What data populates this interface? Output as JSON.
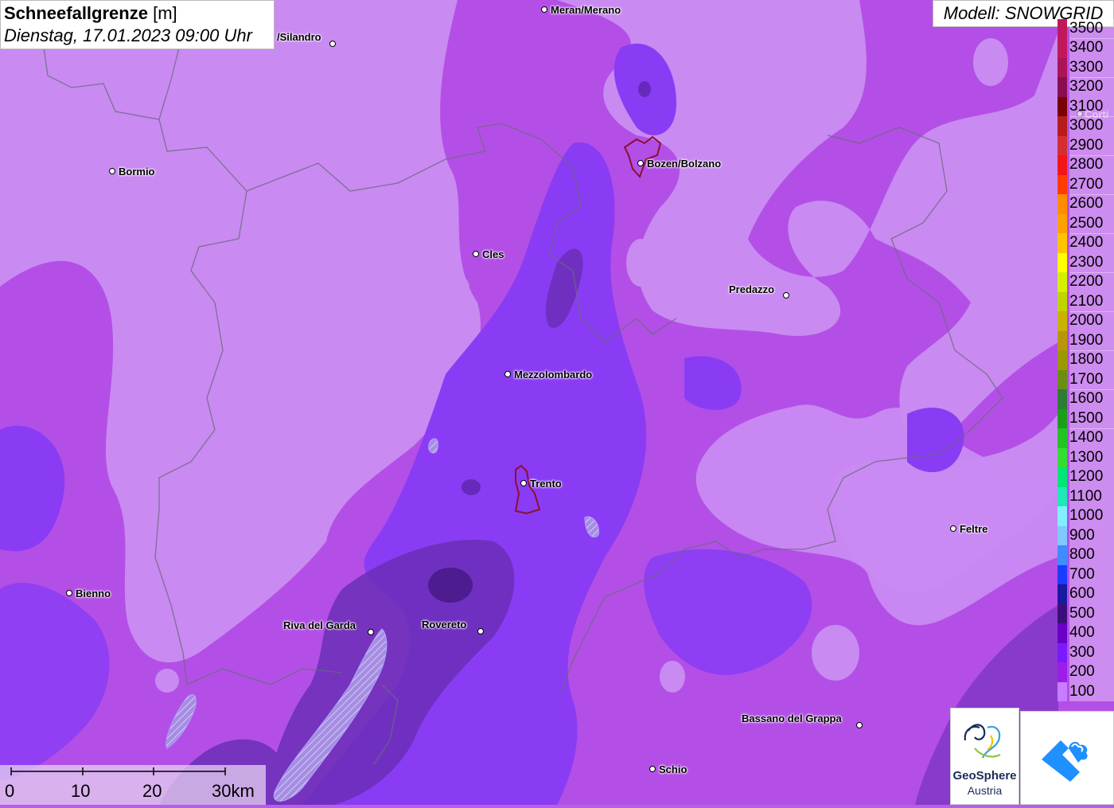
{
  "title": {
    "main": "Schneefallgrenze",
    "unit": "[m]",
    "datetime": "Dienstag, 17.01.2023 09:00 Uhr"
  },
  "model": "Modell: SNOWGRID",
  "legend": [
    {
      "label": "3500",
      "color": "#c2185b"
    },
    {
      "label": "3400",
      "color": "#c2185b"
    },
    {
      "label": "3300",
      "color": "#ad1457"
    },
    {
      "label": "3200",
      "color": "#880e4f"
    },
    {
      "label": "3100",
      "color": "#7b0000"
    },
    {
      "label": "3000",
      "color": "#b71c1c"
    },
    {
      "label": "2900",
      "color": "#d32f2f"
    },
    {
      "label": "2800",
      "color": "#f21616"
    },
    {
      "label": "2700",
      "color": "#ff3d00"
    },
    {
      "label": "2600",
      "color": "#ff8c00"
    },
    {
      "label": "2500",
      "color": "#ffa000"
    },
    {
      "label": "2400",
      "color": "#ffc400"
    },
    {
      "label": "2300",
      "color": "#ffff00"
    },
    {
      "label": "2200",
      "color": "#d4f000"
    },
    {
      "label": "2100",
      "color": "#c0d400"
    },
    {
      "label": "2000",
      "color": "#c7b300"
    },
    {
      "label": "1900",
      "color": "#b8960a"
    },
    {
      "label": "1800",
      "color": "#9a9a00"
    },
    {
      "label": "1700",
      "color": "#6a8f10"
    },
    {
      "label": "1600",
      "color": "#2e7d32"
    },
    {
      "label": "1500",
      "color": "#1b9e1b"
    },
    {
      "label": "1400",
      "color": "#22c322"
    },
    {
      "label": "1300",
      "color": "#33dd33"
    },
    {
      "label": "1200",
      "color": "#00e676"
    },
    {
      "label": "1100",
      "color": "#1de9b6"
    },
    {
      "label": "1000",
      "color": "#80f0ff"
    },
    {
      "label": "900",
      "color": "#80c8ff"
    },
    {
      "label": "800",
      "color": "#3f8cff"
    },
    {
      "label": "700",
      "color": "#1a3cff"
    },
    {
      "label": "600",
      "color": "#1a1aa0"
    },
    {
      "label": "500",
      "color": "#3b0f7a"
    },
    {
      "label": "400",
      "color": "#6a00c8"
    },
    {
      "label": "300",
      "color": "#7a1aff"
    },
    {
      "label": "200",
      "color": "#9b1fe8"
    },
    {
      "label": "100",
      "color": "#c77dff"
    }
  ],
  "cities": [
    {
      "name": "Meran/Merano"
    },
    {
      "name": "/Silandro"
    },
    {
      "name": "Bormio"
    },
    {
      "name": "Bozen/Bolzano"
    },
    {
      "name": "Cles"
    },
    {
      "name": "Predazzo"
    },
    {
      "name": "Mezzolombardo"
    },
    {
      "name": "Trento"
    },
    {
      "name": "Feltre"
    },
    {
      "name": "Bienno"
    },
    {
      "name": "Riva del Garda"
    },
    {
      "name": "Rovereto"
    },
    {
      "name": "Bassano del Grappa"
    },
    {
      "name": "Schio"
    },
    {
      "name": "Corti"
    }
  ],
  "scalebar": {
    "labels": [
      "0",
      "10",
      "20",
      "30km"
    ]
  },
  "logos": {
    "geosphere_line1": "GeoSphere",
    "geosphere_line2": "Austria"
  }
}
